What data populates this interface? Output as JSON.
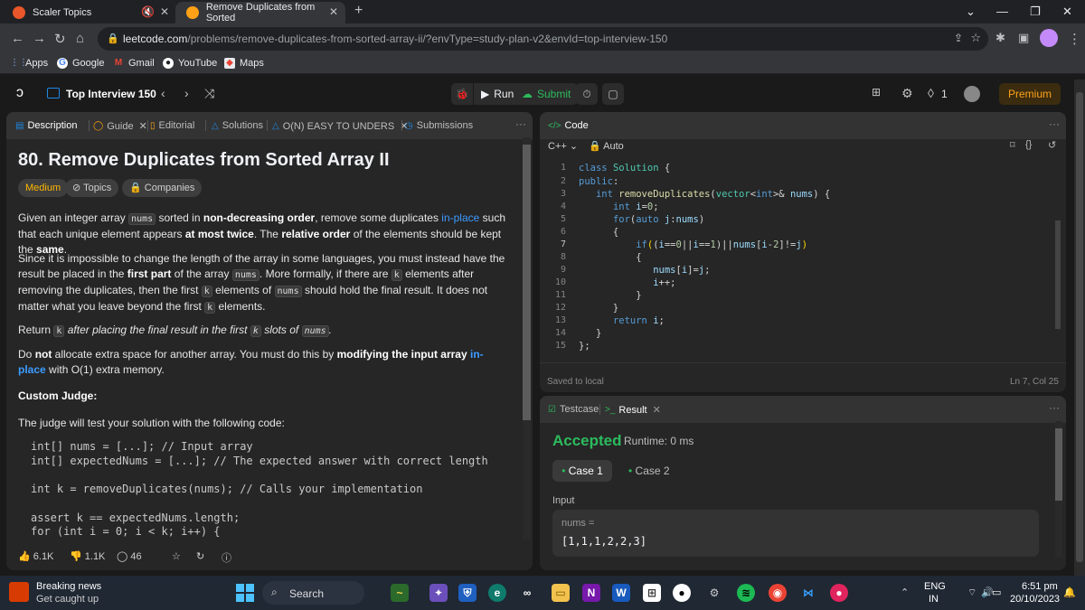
{
  "browser": {
    "tabs": [
      {
        "title": "Scaler Topics"
      },
      {
        "title": "Remove Duplicates from Sorted"
      }
    ],
    "url_host": "leetcode.com",
    "url_path": "/problems/remove-duplicates-from-sorted-array-ii/?envType=study-plan-v2&envId=top-interview-150",
    "bookmarks": [
      "Apps",
      "Google",
      "Gmail",
      "YouTube",
      "Maps"
    ]
  },
  "lc_nav": {
    "list_title": "Top Interview 150",
    "run_label": "Run",
    "submit_label": "Submit",
    "streak_count": "1",
    "premium_label": "Premium"
  },
  "description_panel": {
    "tabs": [
      "Description",
      "Guide",
      "Editorial",
      "Solutions",
      "O(N) EASY TO UNDERS",
      "Submissions"
    ],
    "title": "80. Remove Duplicates from Sorted Array II",
    "difficulty": "Medium",
    "topics_label": "Topics",
    "companies_label": "Companies",
    "custom_judge_heading": "Custom Judge:",
    "judge_intro": "The judge will test your solution with the following code:",
    "judge_code": [
      "int[] nums = [...]; // Input array",
      "int[] expectedNums = [...]; // The expected answer with correct length",
      "",
      "int k = removeDuplicates(nums); // Calls your implementation",
      "",
      "assert k == expectedNums.length;",
      "for (int i = 0; i < k; i++) {"
    ],
    "likes": "6.1K",
    "dislikes": "1.1K",
    "comments": "46"
  },
  "code_panel": {
    "header": "Code",
    "language": "C++",
    "mode": "Auto",
    "line_numbers": [
      "1",
      "2",
      "3",
      "4",
      "5",
      "6",
      "7",
      "8",
      "9",
      "10",
      "11",
      "12",
      "13",
      "14",
      "15"
    ],
    "saved_status": "Saved to local",
    "cursor_position": "Ln 7, Col 25"
  },
  "result_panel": {
    "tabs": [
      "Testcase",
      "Result"
    ],
    "verdict": "Accepted",
    "runtime": "Runtime: 0 ms",
    "case1_label": "Case 1",
    "case2_label": "Case 2",
    "input_heading": "Input",
    "input_var": "nums =",
    "input_value": "[1,1,1,2,2,3]"
  },
  "taskbar": {
    "news_title": "Breaking news",
    "news_subtitle": "Get caught up",
    "search_placeholder": "Search",
    "language": "ENG",
    "language_sub": "IN",
    "time": "6:51 pm",
    "date": "20/10/2023"
  }
}
